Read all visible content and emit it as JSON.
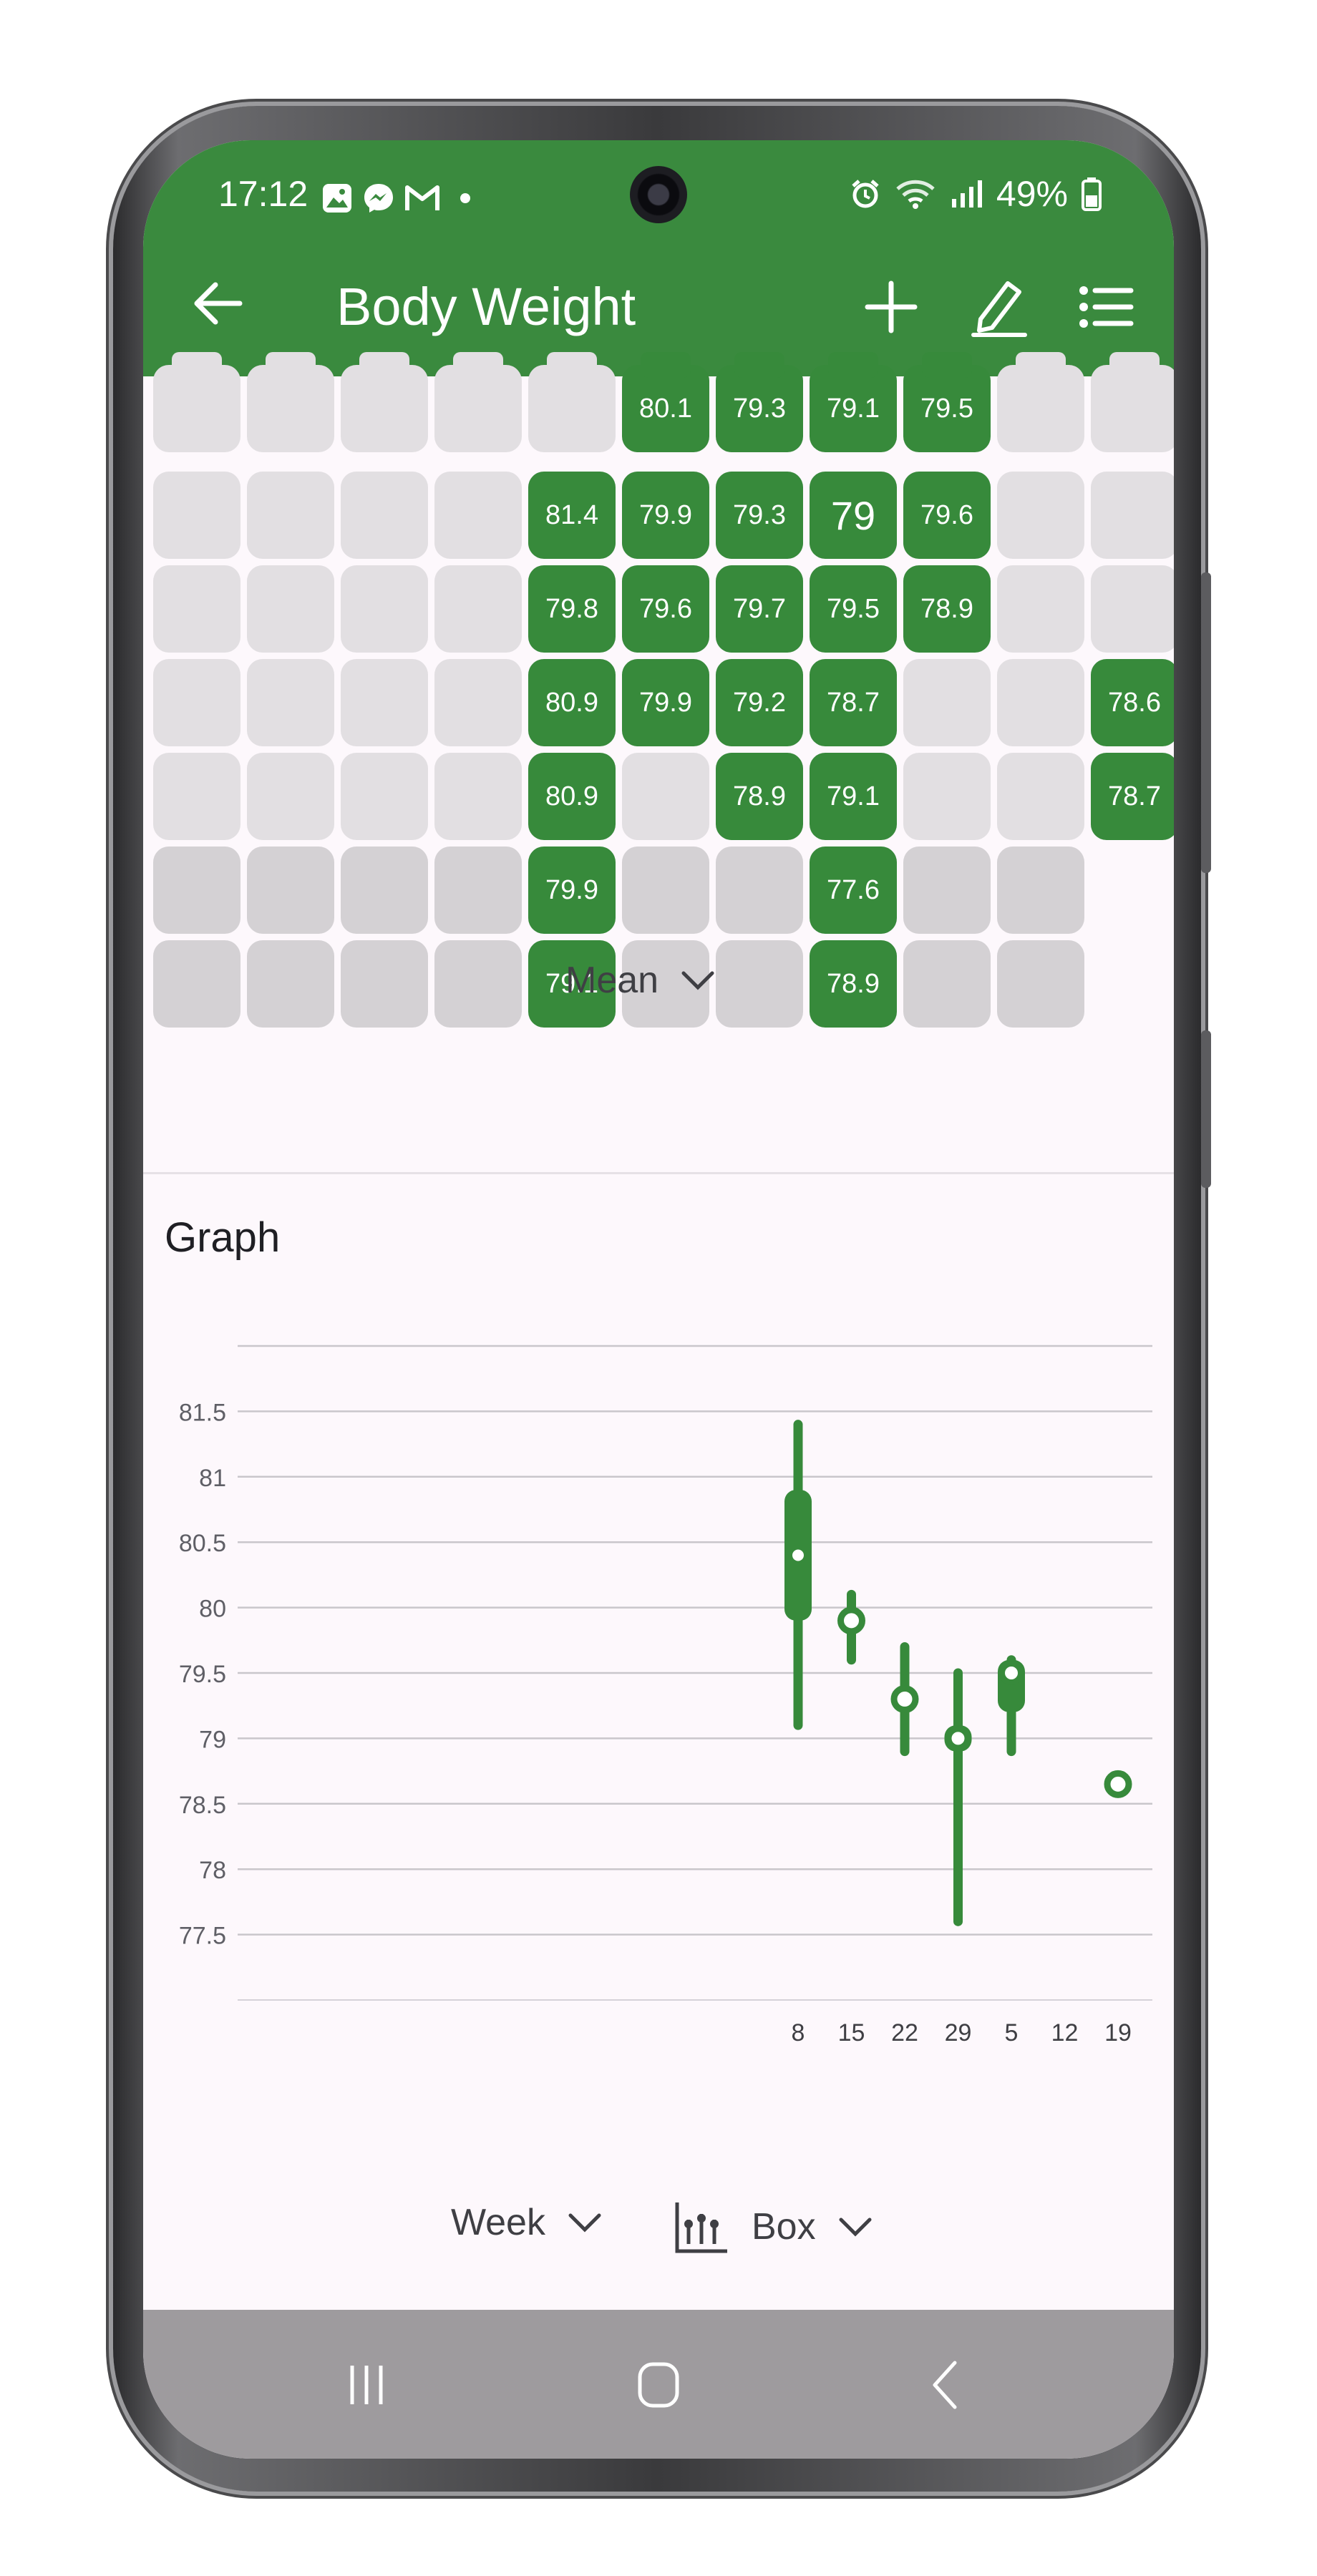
{
  "status": {
    "time": "17:12",
    "battery": "49%",
    "left_icons": [
      "gallery-icon",
      "messenger-icon",
      "gmail-icon",
      "dot-icon"
    ],
    "right_icons": [
      "alarm-icon",
      "wifi-icon",
      "signal-icon",
      "battery-icon"
    ]
  },
  "appbar": {
    "title": "Body Weight",
    "back_icon": "arrow-left-icon",
    "actions": [
      "plus-icon",
      "pencil-icon",
      "list-icon"
    ],
    "color": "#3a8a3e"
  },
  "heatmap": {
    "columns_visible": 11,
    "rows": [
      [
        "",
        "",
        "",
        "",
        "",
        "80.1",
        "79.3",
        "79.1",
        "79.5",
        "",
        ""
      ],
      [
        "",
        "",
        "",
        "",
        "81.4",
        "79.9",
        "79.3",
        "79",
        "79.6",
        "",
        ""
      ],
      [
        "",
        "",
        "",
        "",
        "79.8",
        "79.6",
        "79.7",
        "79.5",
        "78.9",
        "",
        ""
      ],
      [
        "",
        "",
        "",
        "",
        "80.9",
        "79.9",
        "79.2",
        "78.7",
        "",
        "",
        "78.6"
      ],
      [
        "",
        "",
        "",
        "",
        "80.9",
        "",
        "78.9",
        "79.1",
        "",
        "",
        "78.7"
      ],
      [
        "",
        "",
        "",
        "",
        "79.9",
        "",
        "",
        "77.6",
        "",
        "",
        null
      ],
      [
        "",
        "",
        "",
        "",
        "79.1",
        "",
        "",
        "78.9",
        "",
        "",
        null
      ]
    ],
    "aggregate": "Mean",
    "cell_color": "#378a3b"
  },
  "graph": {
    "title": "Graph",
    "period": "Week",
    "chart_style": "Box"
  },
  "chart_data": {
    "type": "box",
    "title": "",
    "xlabel": "",
    "ylabel": "",
    "categories": [
      "8",
      "15",
      "22",
      "29",
      "5",
      "12",
      "19"
    ],
    "yticks": [
      77.5,
      78,
      78.5,
      79,
      79.5,
      80,
      80.5,
      81,
      81.5
    ],
    "ylim": [
      77,
      82
    ],
    "grid": true,
    "series_color": "#378a3b",
    "boxes": [
      {
        "x": "8",
        "min": 79.1,
        "q1": 79.9,
        "median": 80.4,
        "q3": 80.9,
        "max": 81.4
      },
      {
        "x": "15",
        "min": 79.6,
        "q1": 79.9,
        "median": 79.9,
        "q3": 79.9,
        "max": 80.1
      },
      {
        "x": "22",
        "min": 78.9,
        "q1": 79.3,
        "median": 79.3,
        "q3": 79.3,
        "max": 79.7
      },
      {
        "x": "29",
        "min": 77.6,
        "q1": 78.9,
        "median": 79.0,
        "q3": 79.1,
        "max": 79.5
      },
      {
        "x": "5",
        "min": 78.9,
        "q1": 79.2,
        "median": 79.5,
        "q3": 79.6,
        "max": 79.6
      },
      {
        "x": "12",
        "min": null,
        "q1": null,
        "median": null,
        "q3": null,
        "max": null
      },
      {
        "x": "19",
        "min": 78.65,
        "q1": 78.65,
        "median": 78.65,
        "q3": 78.65,
        "max": 78.65
      }
    ]
  },
  "navbar": {
    "buttons": [
      "recent-apps-icon",
      "home-icon",
      "back-icon"
    ]
  }
}
